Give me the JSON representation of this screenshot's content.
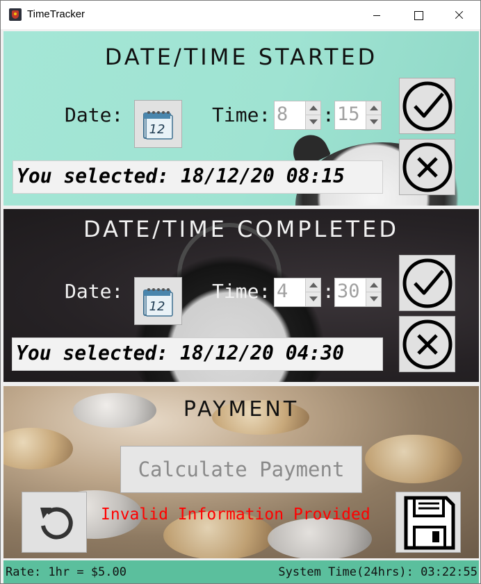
{
  "window": {
    "title": "TimeTracker"
  },
  "started": {
    "heading": "DATE/TIME STARTED",
    "date_label": "Date:",
    "time_label": "Time:",
    "hour": "8",
    "minute": "15",
    "colon": ":",
    "selected_text": "You selected: 18/12/20 08:15"
  },
  "completed": {
    "heading": "DATE/TIME COMPLETED",
    "date_label": "Date:",
    "time_label": "Time:",
    "hour": "4",
    "minute": "30",
    "colon": ":",
    "selected_text": "You selected: 18/12/20 04:30"
  },
  "payment": {
    "heading": "PAYMENT",
    "calculate_label": "Calculate Payment",
    "error_text": "Invalid Information Provided"
  },
  "calendar_day": "12",
  "status": {
    "rate": "Rate: 1hr = $5.00",
    "system_time": "System Time(24hrs): 03:22:55"
  },
  "icons": {
    "app": "app-icon",
    "calendar": "calendar-icon",
    "confirm": "check-circle-icon",
    "cancel": "x-circle-icon",
    "reset": "refresh-icon",
    "save": "floppy-disk-icon"
  },
  "colors": {
    "started_bg": "#9fe3d2",
    "completed_bg": "#262225",
    "status_bar": "#5bbf9d",
    "error": "#ff0000"
  }
}
